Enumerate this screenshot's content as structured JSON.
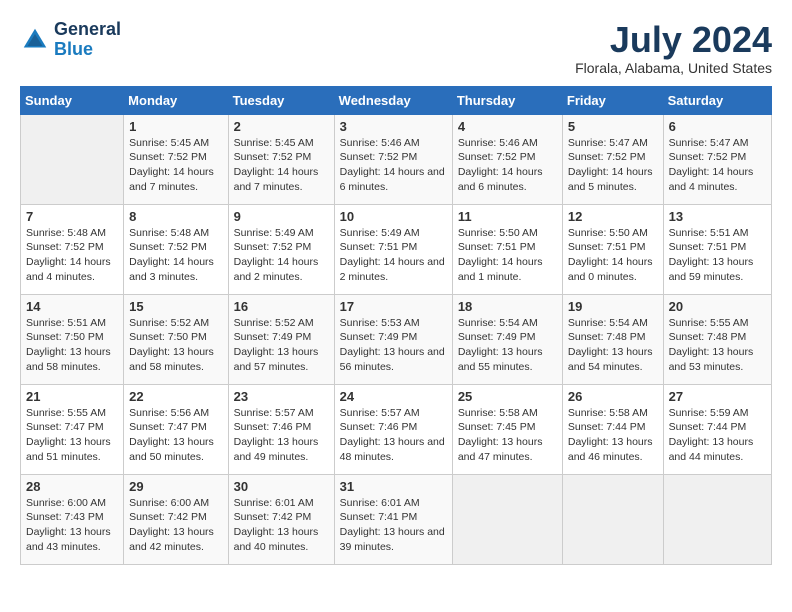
{
  "header": {
    "logo_line1": "General",
    "logo_line2": "Blue",
    "month_year": "July 2024",
    "location": "Florala, Alabama, United States"
  },
  "weekdays": [
    "Sunday",
    "Monday",
    "Tuesday",
    "Wednesday",
    "Thursday",
    "Friday",
    "Saturday"
  ],
  "weeks": [
    [
      {
        "day": "",
        "empty": true
      },
      {
        "day": "1",
        "sunrise": "Sunrise: 5:45 AM",
        "sunset": "Sunset: 7:52 PM",
        "daylight": "Daylight: 14 hours and 7 minutes."
      },
      {
        "day": "2",
        "sunrise": "Sunrise: 5:45 AM",
        "sunset": "Sunset: 7:52 PM",
        "daylight": "Daylight: 14 hours and 7 minutes."
      },
      {
        "day": "3",
        "sunrise": "Sunrise: 5:46 AM",
        "sunset": "Sunset: 7:52 PM",
        "daylight": "Daylight: 14 hours and 6 minutes."
      },
      {
        "day": "4",
        "sunrise": "Sunrise: 5:46 AM",
        "sunset": "Sunset: 7:52 PM",
        "daylight": "Daylight: 14 hours and 6 minutes."
      },
      {
        "day": "5",
        "sunrise": "Sunrise: 5:47 AM",
        "sunset": "Sunset: 7:52 PM",
        "daylight": "Daylight: 14 hours and 5 minutes."
      },
      {
        "day": "6",
        "sunrise": "Sunrise: 5:47 AM",
        "sunset": "Sunset: 7:52 PM",
        "daylight": "Daylight: 14 hours and 4 minutes."
      }
    ],
    [
      {
        "day": "7",
        "sunrise": "Sunrise: 5:48 AM",
        "sunset": "Sunset: 7:52 PM",
        "daylight": "Daylight: 14 hours and 4 minutes."
      },
      {
        "day": "8",
        "sunrise": "Sunrise: 5:48 AM",
        "sunset": "Sunset: 7:52 PM",
        "daylight": "Daylight: 14 hours and 3 minutes."
      },
      {
        "day": "9",
        "sunrise": "Sunrise: 5:49 AM",
        "sunset": "Sunset: 7:52 PM",
        "daylight": "Daylight: 14 hours and 2 minutes."
      },
      {
        "day": "10",
        "sunrise": "Sunrise: 5:49 AM",
        "sunset": "Sunset: 7:51 PM",
        "daylight": "Daylight: 14 hours and 2 minutes."
      },
      {
        "day": "11",
        "sunrise": "Sunrise: 5:50 AM",
        "sunset": "Sunset: 7:51 PM",
        "daylight": "Daylight: 14 hours and 1 minute."
      },
      {
        "day": "12",
        "sunrise": "Sunrise: 5:50 AM",
        "sunset": "Sunset: 7:51 PM",
        "daylight": "Daylight: 14 hours and 0 minutes."
      },
      {
        "day": "13",
        "sunrise": "Sunrise: 5:51 AM",
        "sunset": "Sunset: 7:51 PM",
        "daylight": "Daylight: 13 hours and 59 minutes."
      }
    ],
    [
      {
        "day": "14",
        "sunrise": "Sunrise: 5:51 AM",
        "sunset": "Sunset: 7:50 PM",
        "daylight": "Daylight: 13 hours and 58 minutes."
      },
      {
        "day": "15",
        "sunrise": "Sunrise: 5:52 AM",
        "sunset": "Sunset: 7:50 PM",
        "daylight": "Daylight: 13 hours and 58 minutes."
      },
      {
        "day": "16",
        "sunrise": "Sunrise: 5:52 AM",
        "sunset": "Sunset: 7:49 PM",
        "daylight": "Daylight: 13 hours and 57 minutes."
      },
      {
        "day": "17",
        "sunrise": "Sunrise: 5:53 AM",
        "sunset": "Sunset: 7:49 PM",
        "daylight": "Daylight: 13 hours and 56 minutes."
      },
      {
        "day": "18",
        "sunrise": "Sunrise: 5:54 AM",
        "sunset": "Sunset: 7:49 PM",
        "daylight": "Daylight: 13 hours and 55 minutes."
      },
      {
        "day": "19",
        "sunrise": "Sunrise: 5:54 AM",
        "sunset": "Sunset: 7:48 PM",
        "daylight": "Daylight: 13 hours and 54 minutes."
      },
      {
        "day": "20",
        "sunrise": "Sunrise: 5:55 AM",
        "sunset": "Sunset: 7:48 PM",
        "daylight": "Daylight: 13 hours and 53 minutes."
      }
    ],
    [
      {
        "day": "21",
        "sunrise": "Sunrise: 5:55 AM",
        "sunset": "Sunset: 7:47 PM",
        "daylight": "Daylight: 13 hours and 51 minutes."
      },
      {
        "day": "22",
        "sunrise": "Sunrise: 5:56 AM",
        "sunset": "Sunset: 7:47 PM",
        "daylight": "Daylight: 13 hours and 50 minutes."
      },
      {
        "day": "23",
        "sunrise": "Sunrise: 5:57 AM",
        "sunset": "Sunset: 7:46 PM",
        "daylight": "Daylight: 13 hours and 49 minutes."
      },
      {
        "day": "24",
        "sunrise": "Sunrise: 5:57 AM",
        "sunset": "Sunset: 7:46 PM",
        "daylight": "Daylight: 13 hours and 48 minutes."
      },
      {
        "day": "25",
        "sunrise": "Sunrise: 5:58 AM",
        "sunset": "Sunset: 7:45 PM",
        "daylight": "Daylight: 13 hours and 47 minutes."
      },
      {
        "day": "26",
        "sunrise": "Sunrise: 5:58 AM",
        "sunset": "Sunset: 7:44 PM",
        "daylight": "Daylight: 13 hours and 46 minutes."
      },
      {
        "day": "27",
        "sunrise": "Sunrise: 5:59 AM",
        "sunset": "Sunset: 7:44 PM",
        "daylight": "Daylight: 13 hours and 44 minutes."
      }
    ],
    [
      {
        "day": "28",
        "sunrise": "Sunrise: 6:00 AM",
        "sunset": "Sunset: 7:43 PM",
        "daylight": "Daylight: 13 hours and 43 minutes."
      },
      {
        "day": "29",
        "sunrise": "Sunrise: 6:00 AM",
        "sunset": "Sunset: 7:42 PM",
        "daylight": "Daylight: 13 hours and 42 minutes."
      },
      {
        "day": "30",
        "sunrise": "Sunrise: 6:01 AM",
        "sunset": "Sunset: 7:42 PM",
        "daylight": "Daylight: 13 hours and 40 minutes."
      },
      {
        "day": "31",
        "sunrise": "Sunrise: 6:01 AM",
        "sunset": "Sunset: 7:41 PM",
        "daylight": "Daylight: 13 hours and 39 minutes."
      },
      {
        "day": "",
        "empty": true
      },
      {
        "day": "",
        "empty": true
      },
      {
        "day": "",
        "empty": true
      }
    ]
  ]
}
